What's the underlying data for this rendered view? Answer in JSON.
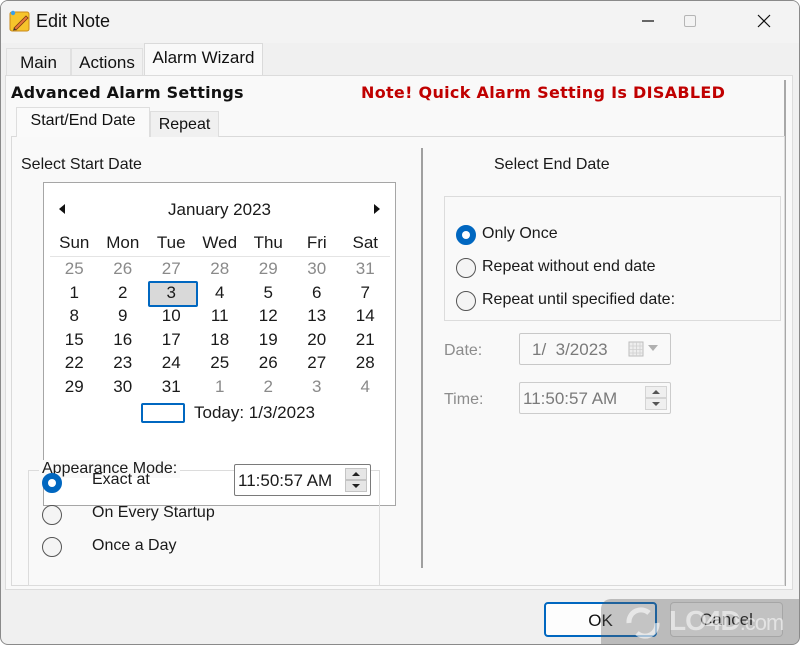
{
  "window": {
    "title": "Edit Note",
    "icon": "sticky-note-pencil-icon",
    "controls": [
      "minimize-icon",
      "maximize-icon",
      "close-icon"
    ]
  },
  "tabs": [
    {
      "label": "Main",
      "active": false
    },
    {
      "label": "Actions",
      "active": false
    },
    {
      "label": "Alarm Wizard",
      "active": true
    }
  ],
  "alarm": {
    "section_title": "Advanced Alarm Settings",
    "notice": "Note! Quick Alarm Setting Is DISABLED",
    "notice_color": "#c00000",
    "subtabs": [
      {
        "label": "Start/End Date",
        "active": true
      },
      {
        "label": "Repeat",
        "active": false
      }
    ],
    "start": {
      "heading": "Select Start Date",
      "calendar": {
        "month_label": "January 2023",
        "prev_icon": "triangle-left-icon",
        "next_icon": "triangle-right-icon",
        "weekdays": [
          "Sun",
          "Mon",
          "Tue",
          "Wed",
          "Thu",
          "Fri",
          "Sat"
        ],
        "weeks": [
          [
            {
              "d": "25",
              "o": true
            },
            {
              "d": "26",
              "o": true
            },
            {
              "d": "27",
              "o": true
            },
            {
              "d": "28",
              "o": true
            },
            {
              "d": "29",
              "o": true
            },
            {
              "d": "30",
              "o": true
            },
            {
              "d": "31",
              "o": true
            }
          ],
          [
            {
              "d": "1"
            },
            {
              "d": "2"
            },
            {
              "d": "3",
              "sel": true
            },
            {
              "d": "4"
            },
            {
              "d": "5"
            },
            {
              "d": "6"
            },
            {
              "d": "7"
            }
          ],
          [
            {
              "d": "8"
            },
            {
              "d": "9"
            },
            {
              "d": "10"
            },
            {
              "d": "11"
            },
            {
              "d": "12"
            },
            {
              "d": "13"
            },
            {
              "d": "14"
            }
          ],
          [
            {
              "d": "15"
            },
            {
              "d": "16"
            },
            {
              "d": "17"
            },
            {
              "d": "18"
            },
            {
              "d": "19"
            },
            {
              "d": "20"
            },
            {
              "d": "21"
            }
          ],
          [
            {
              "d": "22"
            },
            {
              "d": "23"
            },
            {
              "d": "24"
            },
            {
              "d": "25"
            },
            {
              "d": "26"
            },
            {
              "d": "27"
            },
            {
              "d": "28"
            }
          ],
          [
            {
              "d": "29"
            },
            {
              "d": "30"
            },
            {
              "d": "31"
            },
            {
              "d": "1",
              "o": true
            },
            {
              "d": "2",
              "o": true
            },
            {
              "d": "3",
              "o": true
            },
            {
              "d": "4",
              "o": true
            }
          ]
        ],
        "selected_day": "3",
        "today_label": "Today: 1/3/2023"
      },
      "appearance": {
        "legend": "Appearance Mode:",
        "options": [
          {
            "label": "Exact at",
            "checked": true
          },
          {
            "label": "On Every Startup",
            "checked": false
          },
          {
            "label": "Once a Day",
            "checked": false
          }
        ],
        "time_value": "11:50:57 AM"
      }
    },
    "end": {
      "heading": "Select End Date",
      "options": [
        {
          "label": "Only Once",
          "checked": true
        },
        {
          "label": "Repeat without end date",
          "checked": false
        },
        {
          "label": "Repeat until specified date:",
          "checked": false
        }
      ],
      "date_label": "Date:",
      "date_value": "1/  3/2023",
      "time_label": "Time:",
      "time_value": "11:50:57 AM"
    }
  },
  "buttons": {
    "ok": "OK",
    "cancel": "Cancel"
  },
  "watermark": {
    "text": "LO4D",
    "suffix": ".com"
  },
  "colors": {
    "accent": "#0067c0",
    "notice": "#c00000"
  }
}
